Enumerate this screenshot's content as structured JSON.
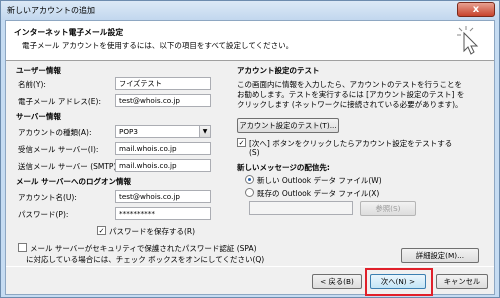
{
  "window": {
    "title": "新しいアカウントの追加",
    "close_glyph": "x"
  },
  "header": {
    "title": "インターネット電子メール設定",
    "subtitle": "電子メール アカウントを使用するには、以下の項目をすべて設定してください。",
    "icon": "cursor-sparkle-icon"
  },
  "user_info": {
    "heading": "ユーザー情報",
    "name_label": "名前(Y):",
    "name_value": "フイズテスト",
    "email_label": "電子メール アドレス(E):",
    "email_value": "test@whois.co.jp"
  },
  "server_info": {
    "heading": "サーバー情報",
    "account_type_label": "アカウントの種類(A):",
    "account_type_value": "POP3",
    "incoming_label": "受信メール サーバー(I):",
    "incoming_value": "mail.whois.co.jp",
    "outgoing_label": "送信メール サーバー (SMTP)(O):",
    "outgoing_value": "mail.whois.co.jp"
  },
  "logon_info": {
    "heading": "メール サーバーへのログオン情報",
    "account_name_label": "アカウント名(U):",
    "account_name_value": "test@whois.co.jp",
    "password_label": "パスワード(P):",
    "password_value": "**********",
    "remember_label": "パスワードを保存する(R)",
    "remember_checked": "✓",
    "spa_line1": "メール サーバーがセキュリティで保護されたパスワード認証 (SPA)",
    "spa_line2": "に対応している場合には、チェック ボックスをオンにしてください(Q)"
  },
  "test": {
    "heading": "アカウント設定のテスト",
    "desc1": "この画面内に情報を入力したら、アカウントのテストを行うことを",
    "desc2": "お勧めします。テストを実行するには [アカウント設定のテスト] を",
    "desc3": "クリックします (ネットワークに接続されている必要があります)。",
    "test_button": "アカウント設定のテスト(T)...",
    "auto_test_line1": "[次へ] ボタンをクリックしたらアカウント設定をテストする",
    "auto_test_line2": "(S)",
    "auto_test_checked": "✓"
  },
  "delivery": {
    "heading": "新しいメッセージの配信先:",
    "option_new": "新しい Outlook データ ファイル(W)",
    "option_existing": "既存の Outlook データ ファイル(X)",
    "browse_button": "参照(S)",
    "more_settings_button": "詳細設定(M)..."
  },
  "footer": {
    "back_button": "< 戻る(B)",
    "next_button": "次へ(N) >",
    "cancel_button": "キャンセル"
  },
  "colors": {
    "highlight": "#e0202a",
    "title_bar": "#c2d7ee"
  }
}
